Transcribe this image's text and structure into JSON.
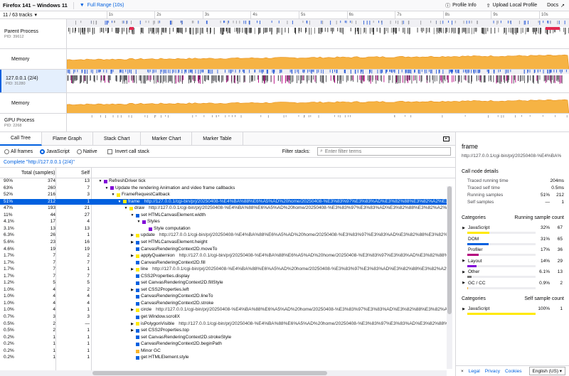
{
  "topbar": {
    "app_title": "Firefox 141 – Windows 11",
    "range_label": "Full Range (10s)",
    "profile_info": "Profile Info",
    "upload": "Upload Local Profile",
    "docs": "Docs"
  },
  "tracks_count": "11 / 63 tracks",
  "ruler_ticks": [
    "1s",
    "2s",
    "3s",
    "4s",
    "5s",
    "6s",
    "7s",
    "8s",
    "9s",
    "10s"
  ],
  "tracks": [
    {
      "name": "Parent Process",
      "pid": "PID: 39612"
    },
    {
      "name": "Memory",
      "pid": ""
    },
    {
      "name": "127.0.0.1 (2/4)",
      "pid": "PID: 31280"
    },
    {
      "name": "Memory",
      "pid": ""
    },
    {
      "name": "GPU Process",
      "pid": "PID: 2268"
    }
  ],
  "tabs": [
    "Call Tree",
    "Flame Graph",
    "Stack Chart",
    "Marker Chart",
    "Marker Table"
  ],
  "toolbar": {
    "all_frames": "All frames",
    "javascript": "JavaScript",
    "native": "Native",
    "invert": "Invert call stack",
    "filter_label": "Filter stacks:",
    "filter_placeholder": "Enter filter terms"
  },
  "breadcrumb": "Complete \"http://127.0.0.1 (2/4)\"",
  "columns": {
    "total": "Total (samples)",
    "self": "Self"
  },
  "colors": {
    "js": "#ffe900",
    "dom": "#0060df",
    "profiler": "#b5007f",
    "layout": "#8000d7",
    "other": "#737373",
    "gc": "#f9b52c",
    "idle": "#d7d7db",
    "memory": "#f5a623",
    "accent": "#0060df"
  },
  "calltree": [
    {
      "pct": "90%",
      "total": "374",
      "self": "13",
      "depth": 0,
      "tw": "▼",
      "cat": "layout",
      "name": "RefreshDriver tick"
    },
    {
      "pct": "63%",
      "total": "260",
      "self": "7",
      "depth": 1,
      "tw": "▼",
      "cat": "layout",
      "name": "Update the rendering Animation and video frame callbacks"
    },
    {
      "pct": "52%",
      "total": "216",
      "self": "3",
      "depth": 2,
      "tw": "▼",
      "cat": "js",
      "name": "FrameRequestCallback"
    },
    {
      "pct": "51%",
      "total": "212",
      "self": "1",
      "depth": 3,
      "tw": "▼",
      "cat": "js",
      "name": "frame",
      "url": "http://127.0.0.1/cgi-bin/prj/20250408-%E4%BA%88%E6%A5%AD%20home/20250408-%E3%83%97%E3%83%AD%E3%82%88%E3%82%A2%E3%83%AB.html",
      "sel": true
    },
    {
      "pct": "47%",
      "total": "193",
      "self": "21",
      "depth": 4,
      "tw": "▼",
      "cat": "js",
      "name": "draw",
      "url": "http://127.0.0.1/cgi-bin/prj/20250408-%E4%BA%88%E6%A5%AD%20home/20250408-%E3%83%97%E3%83%AD%E3%82%88%E3%82%A2%E3%83%AB.html"
    },
    {
      "pct": "11%",
      "total": "44",
      "self": "27",
      "depth": 5,
      "tw": "▼",
      "cat": "dom",
      "name": "set HTMLCanvasElement.width"
    },
    {
      "pct": "4.1%",
      "total": "17",
      "self": "4",
      "depth": 6,
      "tw": "▼",
      "cat": "layout",
      "name": "Styles"
    },
    {
      "pct": "3.1%",
      "total": "13",
      "self": "13",
      "depth": 7,
      "tw": "",
      "cat": "layout",
      "name": "Style computation"
    },
    {
      "pct": "6.3%",
      "total": "26",
      "self": "1",
      "depth": 5,
      "tw": "▶",
      "cat": "js",
      "name": "update",
      "url": "http://127.0.0.1/cgi-bin/prj/20250408-%E4%BA%88%E6%A5%AD%20home/20250408-%E3%83%97%E3%83%AD%E3%82%88%E3%82%A2%E3%83%AB.html"
    },
    {
      "pct": "5.6%",
      "total": "23",
      "self": "16",
      "depth": 5,
      "tw": "▶",
      "cat": "dom",
      "name": "set HTMLCanvasElement.height"
    },
    {
      "pct": "4.6%",
      "total": "19",
      "self": "19",
      "depth": 5,
      "tw": "",
      "cat": "dom",
      "name": "CanvasRenderingContext2D.moveTo"
    },
    {
      "pct": "1.7%",
      "total": "7",
      "self": "2",
      "depth": 5,
      "tw": "▶",
      "cat": "js",
      "name": "applyQuaternion",
      "url": "http://127.0.0.1/cgi-bin/prj/20250408-%E4%BA%88%E6%A5%AD%20home/20250408-%E3%83%97%E3%83%AD%E3%82%88%E3%82%A2%E3%83%AB.html"
    },
    {
      "pct": "1.7%",
      "total": "7",
      "self": "7",
      "depth": 5,
      "tw": "",
      "cat": "dom",
      "name": "CanvasRenderingContext2D.fill"
    },
    {
      "pct": "1.7%",
      "total": "7",
      "self": "1",
      "depth": 5,
      "tw": "▶",
      "cat": "js",
      "name": "line",
      "url": "http://127.0.0.1/cgi-bin/prj/20250408-%E4%BA%88%E6%A5%AD%20home/20250408-%E3%83%97%E3%83%AD%E3%82%88%E3%82%A2%E3%83%AB.html"
    },
    {
      "pct": "1.7%",
      "total": "7",
      "self": "7",
      "depth": 5,
      "tw": "",
      "cat": "dom",
      "name": "CSS2Properties.display"
    },
    {
      "pct": "1.2%",
      "total": "5",
      "self": "5",
      "depth": 5,
      "tw": "",
      "cat": "dom",
      "name": "set CanvasRenderingContext2D.fillStyle"
    },
    {
      "pct": "1.0%",
      "total": "4",
      "self": "2",
      "depth": 5,
      "tw": "▶",
      "cat": "dom",
      "name": "set CSS2Properties.left"
    },
    {
      "pct": "1.0%",
      "total": "4",
      "self": "4",
      "depth": 5,
      "tw": "",
      "cat": "dom",
      "name": "CanvasRenderingContext2D.lineTo"
    },
    {
      "pct": "1.0%",
      "total": "4",
      "self": "4",
      "depth": 5,
      "tw": "",
      "cat": "dom",
      "name": "CanvasRenderingContext2D.stroke"
    },
    {
      "pct": "1.0%",
      "total": "4",
      "self": "1",
      "depth": 5,
      "tw": "▶",
      "cat": "js",
      "name": "circle",
      "url": "http://127.0.0.1/cgi-bin/prj/20250408-%E4%BA%88%E6%A5%AD%20home/20250408-%E3%83%97%E3%83%AD%E3%82%88%E3%82%A2%E3%83%AB.html"
    },
    {
      "pct": "0.7%",
      "total": "3",
      "self": "3",
      "depth": 5,
      "tw": "",
      "cat": "dom",
      "name": "get Window.scrollX"
    },
    {
      "pct": "0.5%",
      "total": "2",
      "self": "—",
      "depth": 5,
      "tw": "▶",
      "cat": "js",
      "name": "isPolygonVisible",
      "url": "http://127.0.0.1/cgi-bin/prj/20250408-%E4%BA%88%E6%A5%AD%20home/20250408-%E3%83%97%E3%83%AD%E3%82%88%E3%82%A2%E3%83%AB.html"
    },
    {
      "pct": "0.5%",
      "total": "2",
      "self": "1",
      "depth": 5,
      "tw": "▶",
      "cat": "dom",
      "name": "set CSS2Properties.top"
    },
    {
      "pct": "0.2%",
      "total": "1",
      "self": "1",
      "depth": 5,
      "tw": "",
      "cat": "dom",
      "name": "set CanvasRenderingContext2D.strokeStyle"
    },
    {
      "pct": "0.2%",
      "total": "1",
      "self": "1",
      "depth": 5,
      "tw": "",
      "cat": "dom",
      "name": "CanvasRenderingContext2D.beginPath"
    },
    {
      "pct": "0.2%",
      "total": "1",
      "self": "1",
      "depth": 5,
      "tw": "",
      "cat": "gc",
      "name": "Minor GC"
    },
    {
      "pct": "0.2%",
      "total": "1",
      "self": "1",
      "depth": 5,
      "tw": "",
      "cat": "dom",
      "name": "get HTMLElement.style"
    }
  ],
  "sidebar": {
    "title": "frame",
    "url": "http://127.0.0.1/cgi-bin/prj/20250408-%E4%BA%88%E6%A5%AD%20home/",
    "details_heading": "Call node details",
    "details": [
      {
        "k": "Traced running time",
        "v1": "",
        "v2": "204ms"
      },
      {
        "k": "Traced self time",
        "v1": "",
        "v2": "0.5ms"
      },
      {
        "k": "Running samples",
        "v1": "51%",
        "v2": "212"
      },
      {
        "k": "Self samples",
        "v1": "—",
        "v2": "1"
      }
    ],
    "cat_heading": "Categories",
    "cat_heading_right": "Running sample count",
    "categories": [
      {
        "name": "JavaScript",
        "pct": "32%",
        "count": "67",
        "frac": 0.32,
        "color": "#ffe900",
        "tw": "▶"
      },
      {
        "name": "DOM",
        "pct": "31%",
        "count": "65",
        "frac": 0.31,
        "color": "#0060df",
        "tw": ""
      },
      {
        "name": "Profiler",
        "pct": "17%",
        "count": "36",
        "frac": 0.17,
        "color": "#b5007f",
        "tw": ""
      },
      {
        "name": "Layout",
        "pct": "14%",
        "count": "29",
        "frac": 0.14,
        "color": "#8000d7",
        "tw": "▶"
      },
      {
        "name": "Other",
        "pct": "6.1%",
        "count": "13",
        "frac": 0.061,
        "color": "#737373",
        "tw": "▶"
      },
      {
        "name": "GC / CC",
        "pct": "0.9%",
        "count": "2",
        "frac": 0.009,
        "color": "#f9b52c",
        "tw": "▶"
      }
    ],
    "self_heading": "Categories",
    "self_heading_right": "Self sample count",
    "self_categories": [
      {
        "name": "JavaScript",
        "pct": "100%",
        "count": "1",
        "frac": 1.0,
        "color": "#ffe900",
        "tw": "▶"
      }
    ]
  },
  "footer": {
    "legal": "Legal",
    "privacy": "Privacy",
    "cookies": "Cookies",
    "language": "English (US)"
  }
}
